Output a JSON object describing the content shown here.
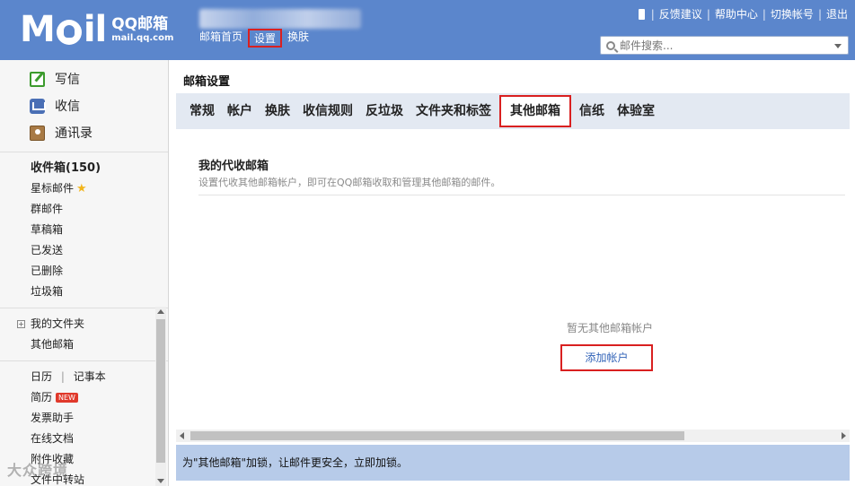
{
  "header": {
    "logo_m": "M",
    "logo_il": "il",
    "logo_cn": "QQ邮箱",
    "logo_url": "mail.qq.com",
    "topnav": [
      "邮箱首页",
      "设置",
      "换肤"
    ],
    "toplinks": [
      "反馈建议",
      "帮助中心",
      "切换帐号",
      "退出"
    ],
    "search_placeholder": "邮件搜索..."
  },
  "sidebar": {
    "quick": [
      "写信",
      "收信",
      "通讯录"
    ],
    "folders": {
      "inbox": "收件箱(150)",
      "starred": "星标邮件",
      "group": "群邮件",
      "drafts": "草稿箱",
      "sent": "已发送",
      "deleted": "已删除",
      "spam": "垃圾箱"
    },
    "my_folders": "我的文件夹",
    "other_mail": "其他邮箱",
    "calendar": "日历",
    "notebook": "记事本",
    "resume": "简历",
    "resume_badge": "NEW",
    "invoice": "发票助手",
    "docs": "在线文档",
    "attachments": "附件收藏",
    "file_transfer": "文件中转站"
  },
  "watermark": "大众跨境",
  "main": {
    "title": "邮箱设置",
    "tabs": [
      "常规",
      "帐户",
      "换肤",
      "收信规则",
      "反垃圾",
      "文件夹和标签",
      "其他邮箱",
      "信纸",
      "体验室"
    ],
    "active_tab": "其他邮箱",
    "section_title": "我的代收邮箱",
    "section_desc": "设置代收其他邮箱帐户，即可在QQ邮箱收取和管理其他邮箱的邮件。",
    "empty_text": "暂无其他邮箱帐户",
    "add_button": "添加帐户",
    "bottom_notice": "为\"其他邮箱\"加锁，让邮件更安全，立即加锁。"
  },
  "colors": {
    "header_bg": "#5b86cc",
    "highlight_border": "#d92020",
    "tab_bar_bg": "#e3e9f2",
    "bottom_bar_bg": "#b7cbe9",
    "link": "#3364b8"
  }
}
